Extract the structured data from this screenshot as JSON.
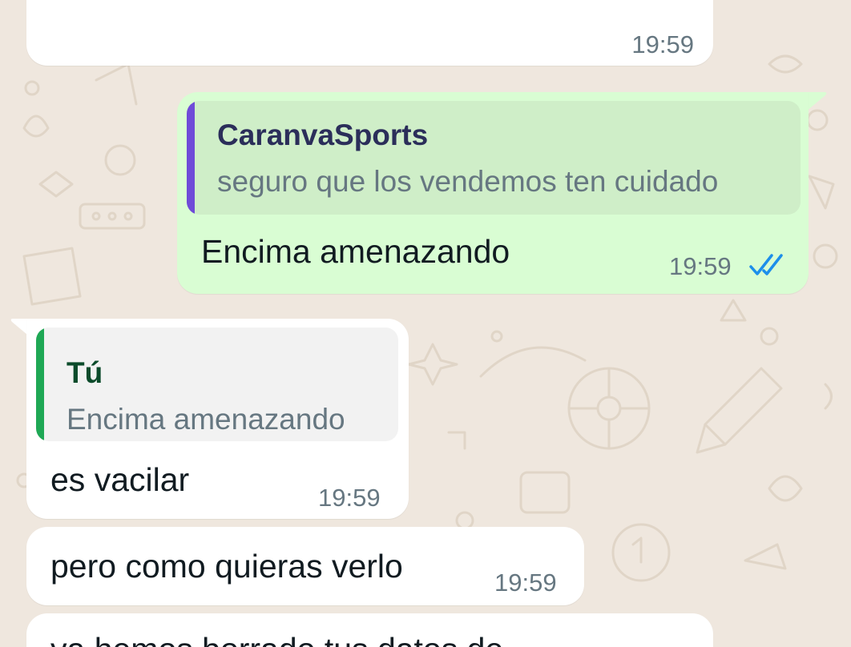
{
  "chat": {
    "messages": [
      {
        "direction": "incoming",
        "text": "",
        "time": "19:59"
      },
      {
        "direction": "outgoing",
        "quote": {
          "author": "CaranvaSports",
          "text": "seguro que los vendemos ten cuidado",
          "accent": "#6f4bd8"
        },
        "text": "Encima amenazando",
        "time": "19:59",
        "status": "read",
        "status_icon": "double-check-icon",
        "status_color": "#1d8fea"
      },
      {
        "direction": "incoming",
        "quote": {
          "author": "Tú",
          "text": "Encima amenazando",
          "accent": "#1fa855"
        },
        "text": "es vacilar",
        "time": "19:59"
      },
      {
        "direction": "incoming",
        "text": "pero como quieras verlo",
        "time": "19:59"
      },
      {
        "direction": "incoming",
        "text": "ya hemos borrado tus datos de",
        "time": ""
      }
    ]
  },
  "colors": {
    "background": "#efe7de",
    "incoming_bubble": "#ffffff",
    "outgoing_bubble": "#d9fdd3",
    "timestamp": "#667781",
    "text": "#111b21"
  }
}
